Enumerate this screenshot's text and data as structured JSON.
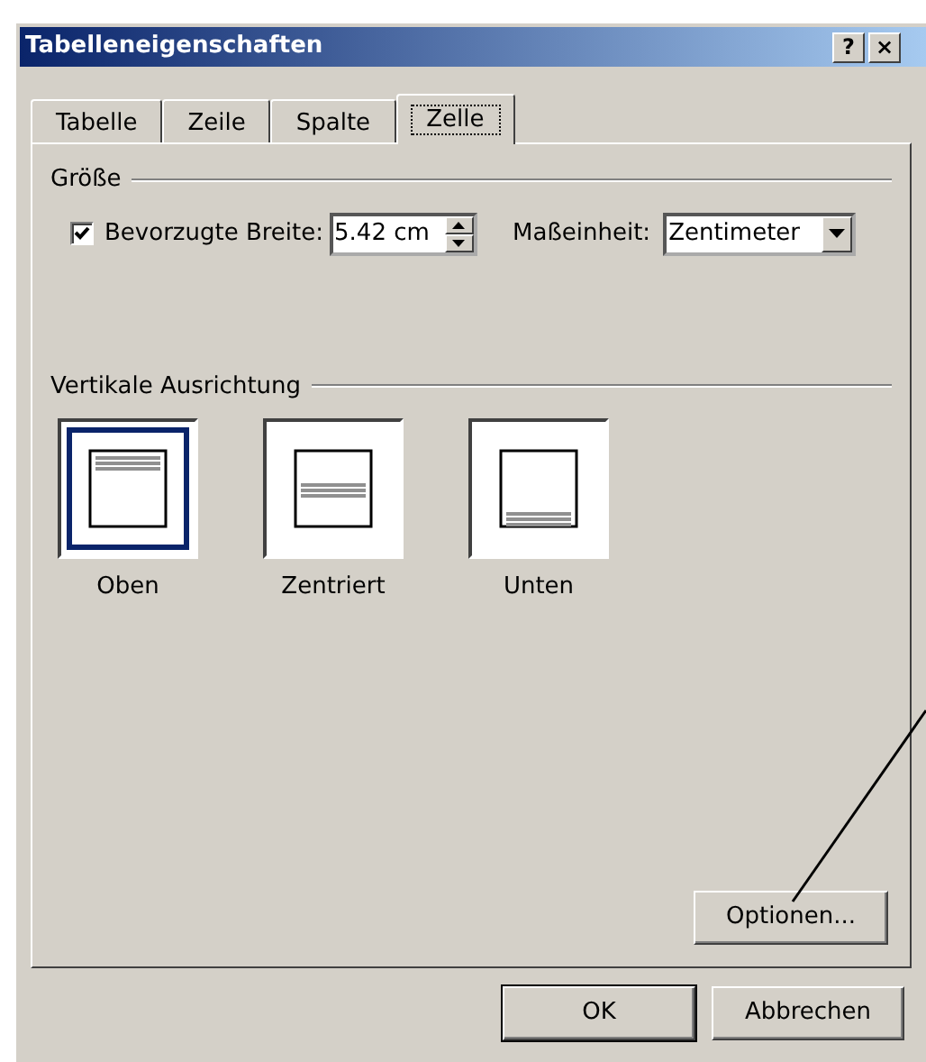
{
  "window": {
    "title": "Tabelleneigenschaften",
    "buttons": [
      "?",
      "×"
    ]
  },
  "tabs": [
    {
      "label": "Tabelle",
      "selected": false
    },
    {
      "label": "Zeile",
      "selected": false
    },
    {
      "label": "Spalte",
      "selected": false
    },
    {
      "label": "Zelle",
      "selected": true
    }
  ],
  "size_group": {
    "title": "Größe",
    "preferred_width": {
      "label": "Bevorzugte Breite:",
      "checked": true,
      "value": "5.42 cm"
    },
    "unit": {
      "label": "Maßeinheit:",
      "value": "Zentimeter"
    }
  },
  "vertical_alignment": {
    "title": "Vertikale Ausrichtung",
    "options": [
      {
        "label": "Oben",
        "kind": "top",
        "selected": true
      },
      {
        "label": "Zentriert",
        "kind": "center",
        "selected": false
      },
      {
        "label": "Unten",
        "kind": "bottom",
        "selected": false
      }
    ]
  },
  "options_button": {
    "label": "Optionen..."
  },
  "buttons": [
    {
      "label": "OK",
      "default": true
    },
    {
      "label": "Abbrechen",
      "default": false
    }
  ]
}
